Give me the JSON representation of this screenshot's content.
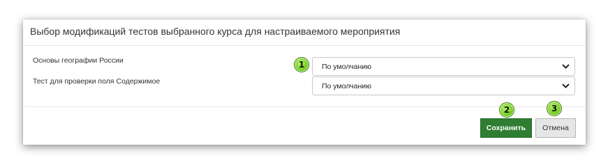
{
  "dialog": {
    "title": "Выбор модификаций тестов выбранного курса для настраиваемого мероприятия"
  },
  "rows": [
    {
      "label": "Основы географии России",
      "selected": "По умолчанию"
    },
    {
      "label": "Тест для проверки поля Содержимое",
      "selected": "По умолчанию"
    }
  ],
  "buttons": {
    "save_label": "Сохранить",
    "cancel_label": "Отмена"
  },
  "badges": [
    "1",
    "2",
    "3"
  ],
  "icons": {
    "dropdown": "chevron-down-icon"
  },
  "colors": {
    "save_button": "#2e7d32",
    "cancel_button": "#e6e6e6",
    "badge": "#7bd12a"
  }
}
